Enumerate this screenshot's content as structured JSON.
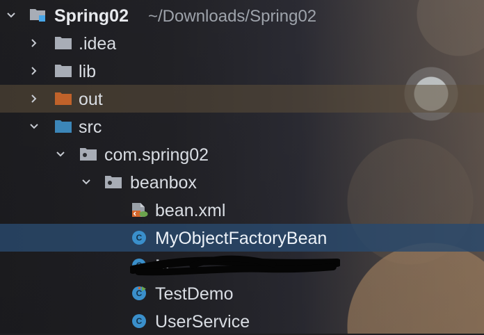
{
  "project": {
    "name": "Spring02",
    "path": "~/Downloads/Spring02"
  },
  "tree": {
    "items": [
      {
        "label": ".idea"
      },
      {
        "label": "lib"
      },
      {
        "label": "out"
      },
      {
        "label": "src"
      },
      {
        "label": "com.spring02"
      },
      {
        "label": "beanbox"
      },
      {
        "label": "bean.xml"
      },
      {
        "label": "MyObjectFactoryBean"
      },
      {
        "label": "M"
      },
      {
        "label": "TestDemo"
      },
      {
        "label": "UserService"
      }
    ]
  },
  "colors": {
    "selection": "#2A496C",
    "excluded_folder": "#C0622A",
    "source_folder": "#3C86B8",
    "class_icon": "#3A8FCB",
    "spring_green": "#6BA34C"
  },
  "icons": {
    "project": "module-folder-icon",
    "folder": "folder-icon",
    "package": "package-icon",
    "xml": "spring-xml-file-icon",
    "class": "java-class-icon",
    "run_class": "runnable-class-icon"
  }
}
